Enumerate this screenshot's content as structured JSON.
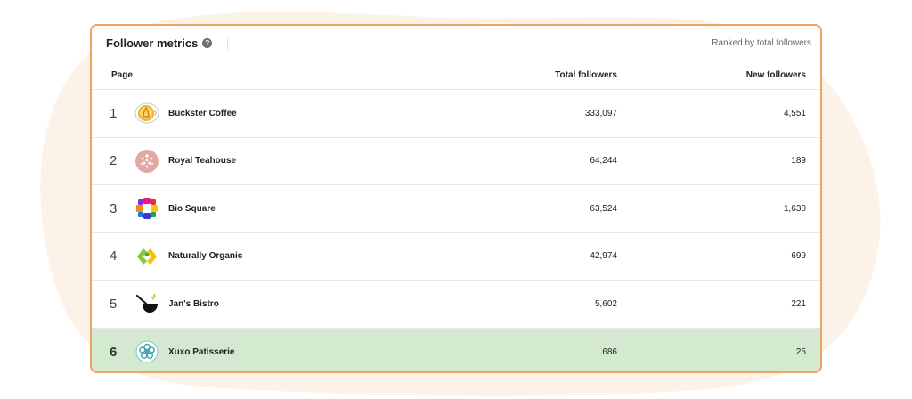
{
  "card": {
    "title": "Follower metrics",
    "help_icon": "help-circle-icon",
    "subtitle": "Ranked by total followers"
  },
  "columns": {
    "page": "Page",
    "total": "Total followers",
    "new": "New followers"
  },
  "rows": [
    {
      "rank": "1",
      "name": "Buckster Coffee",
      "total": "333,097",
      "new": "4,551",
      "icon": "coffee-cup-logo-icon"
    },
    {
      "rank": "2",
      "name": "Royal Teahouse",
      "total": "64,244",
      "new": "189",
      "icon": "tea-blossom-logo-icon"
    },
    {
      "rank": "3",
      "name": "Bio Square",
      "total": "63,524",
      "new": "1,630",
      "icon": "bio-square-logo-icon"
    },
    {
      "rank": "4",
      "name": "Naturally Organic",
      "total": "42,974",
      "new": "699",
      "icon": "naturally-organic-logo-icon"
    },
    {
      "rank": "5",
      "name": "Jan's Bistro",
      "total": "5,602",
      "new": "221",
      "icon": "bistro-pan-logo-icon"
    },
    {
      "rank": "6",
      "name": "Xuxo Patisserie",
      "total": "686",
      "new": "25",
      "icon": "patisserie-flower-logo-icon"
    }
  ],
  "colors": {
    "card_border": "#f0a35e",
    "highlight_row": "#d4ead0",
    "background_blob": "#fdf2e8"
  }
}
